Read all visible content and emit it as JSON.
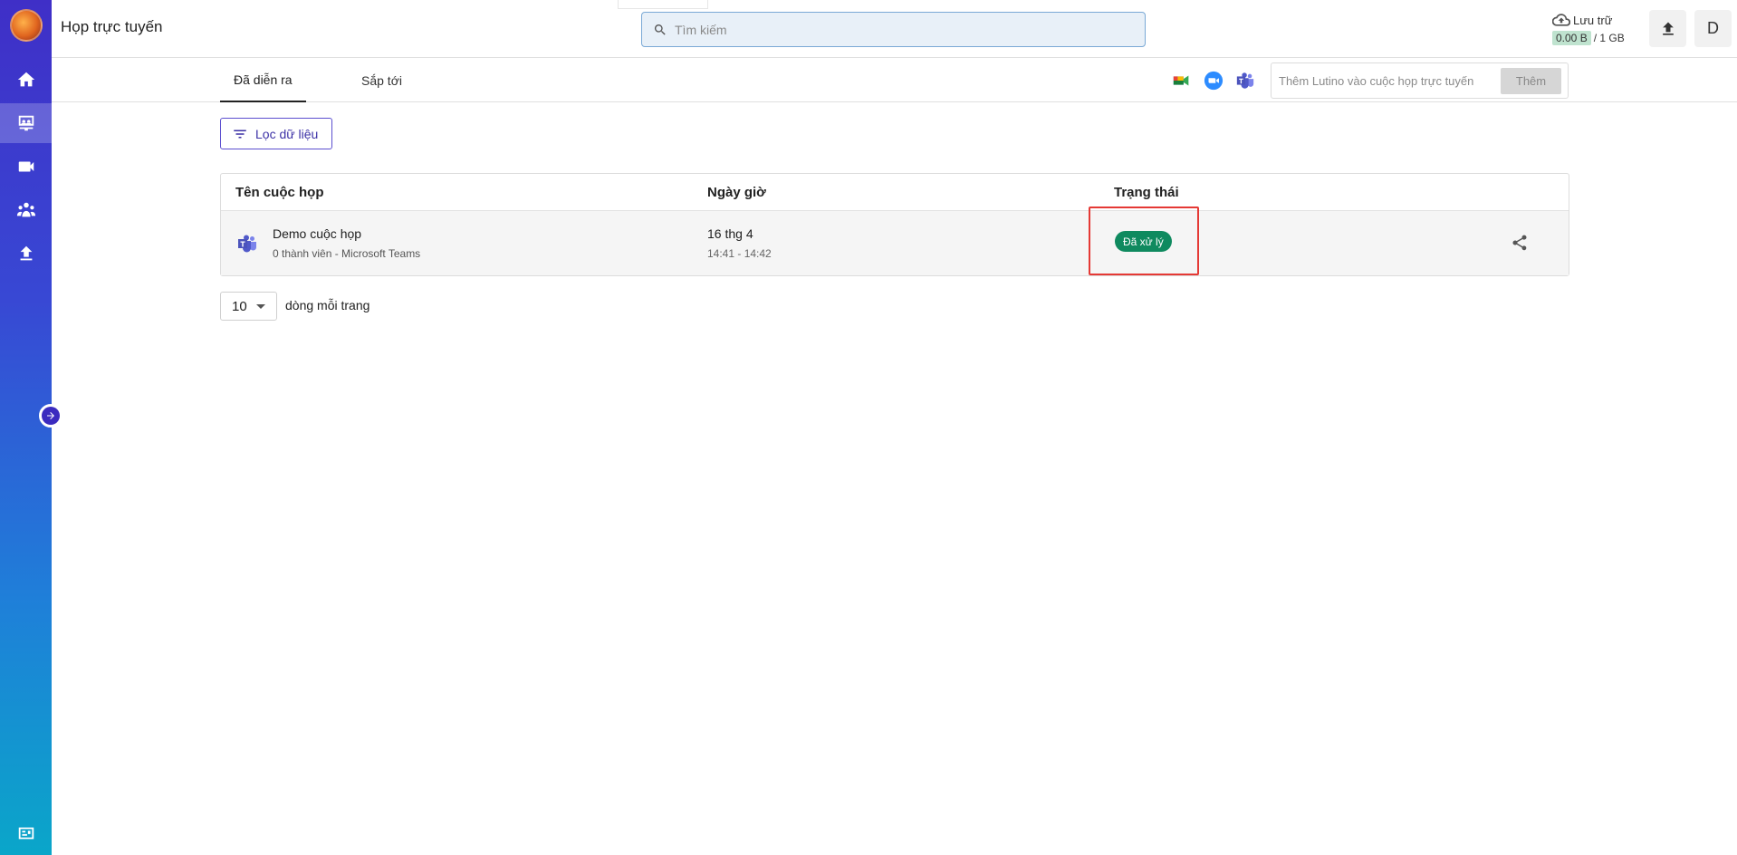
{
  "app": {
    "title": "Họp trực tuyến"
  },
  "search": {
    "placeholder": "Tìm kiếm"
  },
  "storage": {
    "label": "Lưu trữ",
    "used": "0.00 B",
    "total": "/ 1 GB"
  },
  "user": {
    "avatar_letter": "D"
  },
  "tabs": [
    {
      "label": "Đã diễn ra",
      "active": true
    },
    {
      "label": "Sắp tới",
      "active": false
    }
  ],
  "add_bot": {
    "placeholder": "Thêm Lutino vào cuộc họp trực tuyến",
    "button_label": "Thêm"
  },
  "filter": {
    "label": "Lọc dữ liệu"
  },
  "table": {
    "headers": [
      "Tên cuộc họp",
      "Ngày giờ",
      "Trạng thái"
    ],
    "rows": [
      {
        "name": "Demo cuộc họp",
        "sub": "0 thành viên - Microsoft Teams",
        "date": "16 thg 4",
        "time": "14:41 - 14:42",
        "status": "Đã xử lý"
      }
    ]
  },
  "pagination": {
    "rows_per_page": "10",
    "label": "dòng mỗi trang"
  },
  "colors": {
    "accent": "#3c31a6",
    "status_done": "#0f8a5f",
    "highlight": "#e53935"
  }
}
